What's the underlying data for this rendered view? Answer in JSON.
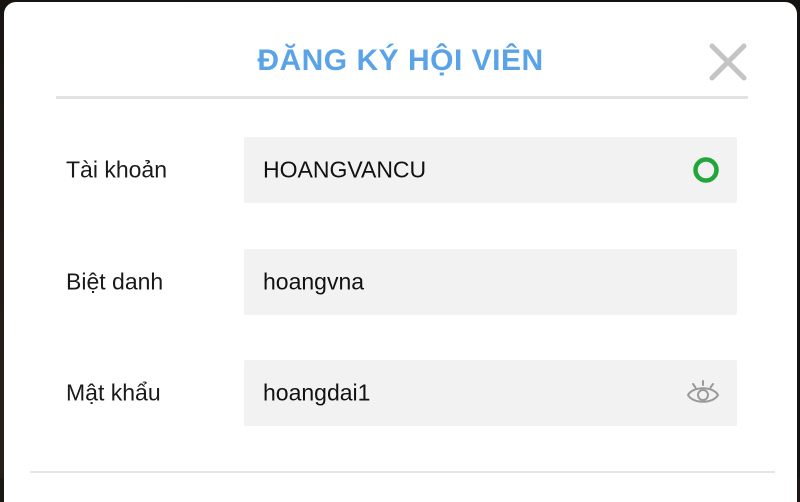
{
  "dialog": {
    "title": "ĐĂNG KÝ HỘI VIÊN"
  },
  "form": {
    "fields": [
      {
        "label": "Tài khoản",
        "value": "HOANGVANCU",
        "icon": "valid-check-circle-icon",
        "icon_color": "#22a63a"
      },
      {
        "label": "Biệt danh",
        "value": "hoangvna"
      },
      {
        "label": "Mật khẩu",
        "value": "hoangdai1",
        "icon": "eye-icon",
        "icon_color": "#9a9a9a"
      }
    ]
  },
  "colors": {
    "title": "#5aa3e6",
    "close_icon": "#c4c4c4",
    "field_background": "#f2f2f2"
  }
}
